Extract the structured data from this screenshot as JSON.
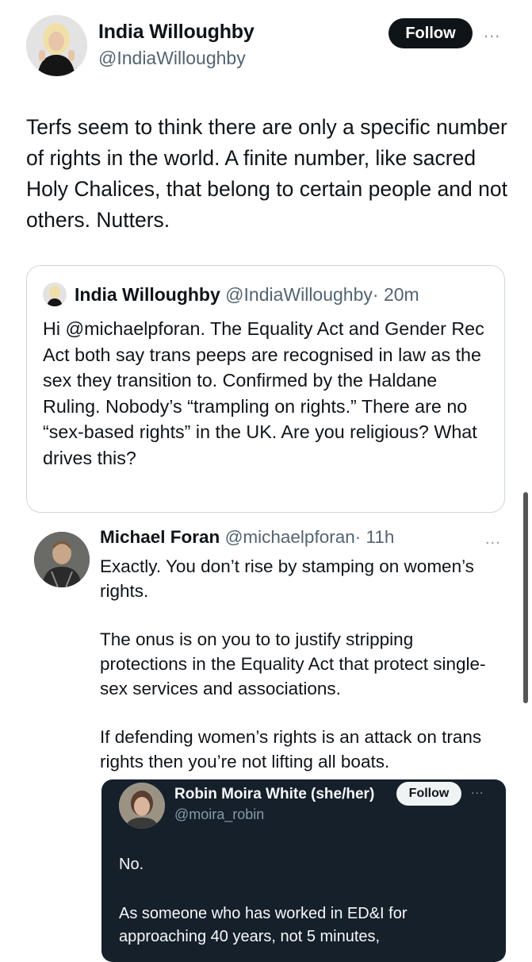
{
  "tweet": {
    "author_name": "India Willoughby",
    "author_handle": "@IndiaWilloughby",
    "follow_label": "Follow",
    "more_icon": "...",
    "text": "Terfs seem to think there are only a specific number of rights in the world. A finite number, like sacred Holy Chalices, that belong to certain people and not others. Nutters."
  },
  "quote": {
    "author_name": "India Willoughby",
    "author_handle": "@IndiaWilloughby",
    "time": "· 20m",
    "text": "Hi @michaelpforan. The Equality Act and Gender Rec Act both say trans peeps are recognised in law as the sex they transition to. Confirmed by the Haldane Ruling. Nobody’s “trampling on rights.” There are no “sex-based rights” in the UK. Are you religious? What drives this?"
  },
  "reply": {
    "author_name": "Michael Foran",
    "author_handle": "@michaelpforan",
    "time": "· 11h",
    "more_icon": "...",
    "paragraphs": [
      "Exactly. You don’t rise by stamping on women’s rights.",
      "The onus is on you to to justify stripping protections in the Equality Act that protect single-sex services and associations.",
      "If defending women’s rights is an attack on trans rights then you’re not lifting all boats."
    ]
  },
  "embedded": {
    "author_name": "Robin Moira White (she/her)",
    "author_handle": "@moira_robin",
    "follow_label": "Follow",
    "more_icon": "...",
    "paragraphs": [
      "No.",
      "As someone who has worked in ED&I for approaching 40 years, not 5 minutes,"
    ]
  },
  "colors": {
    "text": "#0f1419",
    "secondary": "#536471",
    "follow_bg": "#0f1419",
    "dark_bg": "#15202b"
  }
}
